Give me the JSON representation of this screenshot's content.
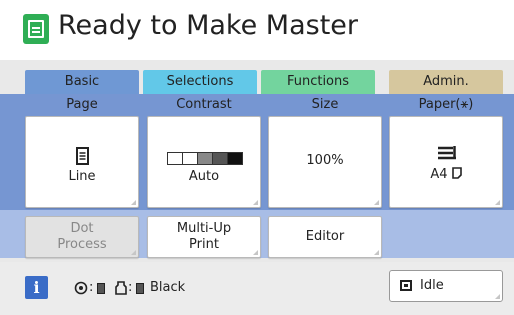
{
  "title": {
    "text": "Ready to Make Master"
  },
  "tabs": [
    {
      "label": "Basic",
      "color": "#6f98d4"
    },
    {
      "label": "Selections",
      "color": "#62c8e8"
    },
    {
      "label": "Functions",
      "color": "#73d49e"
    },
    {
      "label": "Admin.",
      "color": "#d6c79e"
    }
  ],
  "columns": {
    "page": "Page",
    "contrast": "Contrast",
    "size": "Size",
    "paper": "Paper(⚹)"
  },
  "buttons": {
    "page_value": "Line",
    "page_icon": "document-icon",
    "contrast_value": "Auto",
    "contrast_levels": 5,
    "contrast_level_selected": 2,
    "size_value": "100%",
    "paper_value": "A4",
    "paper_icon": "paper-stack-icon",
    "dot_process": "Dot\nProcess",
    "multi_up": "Multi-Up\nPrint",
    "editor": "Editor"
  },
  "status": {
    "info_label": "i",
    "drum_value": ":",
    "ink_value": ":",
    "ink_color": "Black",
    "idle_label": "Idle"
  }
}
